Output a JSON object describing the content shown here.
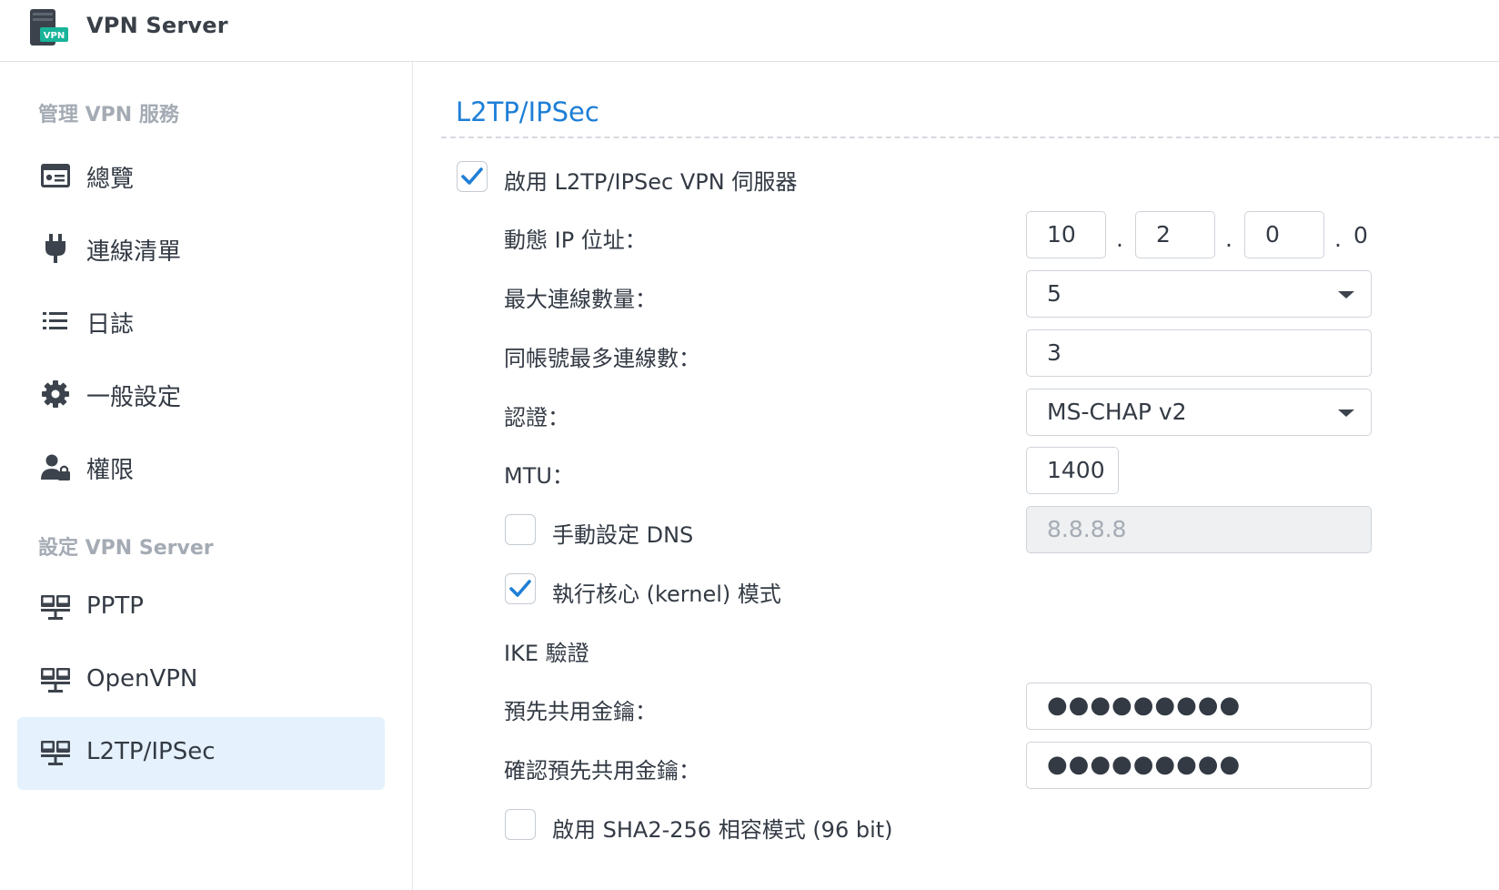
{
  "header": {
    "app_badge": "VPN",
    "title": "VPN Server"
  },
  "sidebar": {
    "section_manage": "管理 VPN 服務",
    "manage_items": [
      {
        "label": "總覽",
        "icon": "overview-card-icon"
      },
      {
        "label": "連線清單",
        "icon": "plug-icon"
      },
      {
        "label": "日誌",
        "icon": "list-icon"
      },
      {
        "label": "一般設定",
        "icon": "gear-icon"
      },
      {
        "label": "權限",
        "icon": "user-lock-icon"
      }
    ],
    "section_config": "設定 VPN Server",
    "config_items": [
      {
        "label": "PPTP",
        "icon": "network-icon"
      },
      {
        "label": "OpenVPN",
        "icon": "network-icon"
      },
      {
        "label": "L2TP/IPSec",
        "icon": "network-icon",
        "active": true
      }
    ]
  },
  "content": {
    "title": "L2TP/IPSec",
    "enable_server": {
      "label": "啟用 L2TP/IPSec VPN 伺服器",
      "checked": true
    },
    "dynamic_ip": {
      "label": "動態 IP 位址：",
      "octets": [
        "10",
        "2",
        "0"
      ],
      "dot": ".",
      "last_octet": "0"
    },
    "max_connections": {
      "label": "最大連線數量：",
      "value": "5"
    },
    "max_per_account": {
      "label": "同帳號最多連線數：",
      "value": "3"
    },
    "auth": {
      "label": "認證：",
      "value": "MS-CHAP v2"
    },
    "mtu": {
      "label": "MTU：",
      "value": "1400"
    },
    "manual_dns": {
      "label": "手動設定 DNS",
      "checked": false,
      "value": "8.8.8.8"
    },
    "kernel_mode": {
      "label": "執行核心 (kernel) 模式",
      "checked": true
    },
    "ike_auth": {
      "label": "IKE 驗證"
    },
    "psk": {
      "label": "預先共用金鑰：",
      "value": "●●●●●●●●●"
    },
    "psk_confirm": {
      "label": "確認預先共用金鑰：",
      "value": "●●●●●●●●●"
    },
    "sha2": {
      "label": "啟用 SHA2-256 相容模式 (96 bit)",
      "checked": false
    }
  },
  "colors": {
    "accent": "#1e7fd6",
    "active_bg": "#e5f1fc",
    "text": "#333a44",
    "muted": "#a4abb4",
    "icon": "#3c434c"
  }
}
